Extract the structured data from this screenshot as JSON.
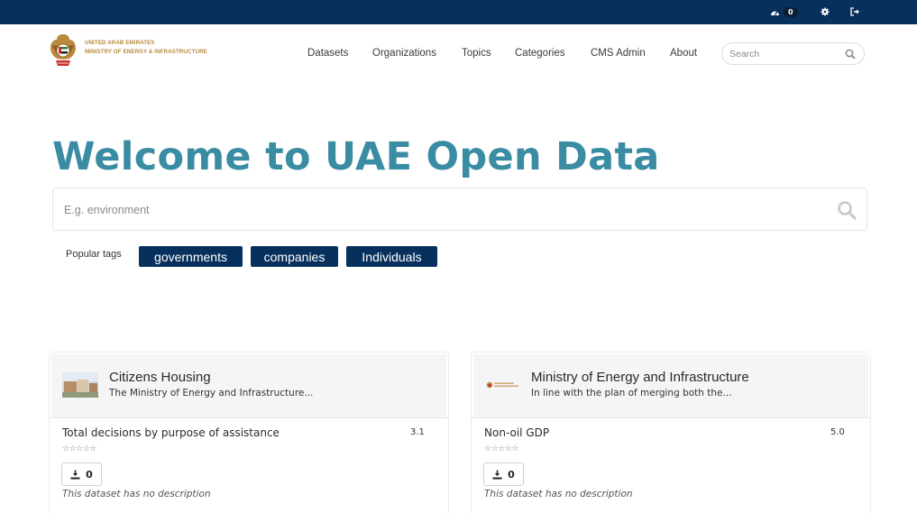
{
  "topbar": {
    "dashboard_icon": "dashboard-icon",
    "dashboard_count": "0",
    "settings_icon": "gear-icon",
    "logout_icon": "sign-out-icon"
  },
  "header": {
    "logo_line1": "UNITED ARAB EMIRATES",
    "logo_line2": "MINISTRY OF ENERGY & INFRASTRUCTURE",
    "nav": [
      "Datasets",
      "Organizations",
      "Topics",
      "Categories",
      "CMS Admin",
      "About"
    ],
    "search_placeholder": "Search"
  },
  "hero": {
    "title": "Welcome to UAE Open Data",
    "search_placeholder": "E.g. environment",
    "tags_label": "Popular tags",
    "tags": [
      "governments",
      "companies",
      "Individuals"
    ]
  },
  "cards": [
    {
      "org_title": "Citizens Housing",
      "org_desc": "The Ministry of Energy and Infrastructure...",
      "dataset_title": "Total decisions by purpose of assistance",
      "rating": "3.1",
      "downloads": "0",
      "no_desc": "This dataset has no description"
    },
    {
      "org_title": "Ministry of Energy and Infrastructure",
      "org_desc": "In line with the plan of merging both the...",
      "dataset_title": "Non-oil GDP",
      "rating": "5.0",
      "downloads": "0",
      "no_desc": "This dataset has no description"
    }
  ],
  "colors": {
    "navy": "#08305d",
    "hero_teal": "#3a8ca2",
    "logo_gold": "#b98a3e"
  }
}
